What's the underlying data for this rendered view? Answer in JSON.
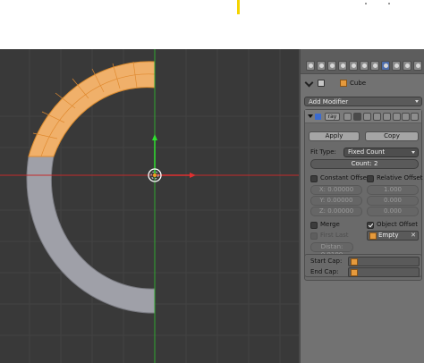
{
  "properties": {
    "context": {
      "object_name": "Cube"
    },
    "add_modifier_label": "Add Modifier",
    "modifier": {
      "name": "ray",
      "apply_label": "Apply",
      "copy_label": "Copy",
      "fit_type_label": "Fit Type:",
      "fit_type_value": "Fixed Count",
      "count_label": "Count: 2",
      "constant_offset_label": "Constant Offset",
      "relative_offset_label": "Relative Offset",
      "constant_offset_checked": false,
      "relative_offset_checked": false,
      "constant_x": "X: 0.00000",
      "constant_y": "Y: 0.00000",
      "constant_z": "Z: 0.00000",
      "relative_x": "1.000",
      "relative_y": "0.000",
      "relative_z": "0.000",
      "merge_label": "Merge",
      "merge_checked": false,
      "object_offset_label": "Object Offset",
      "object_offset_checked": true,
      "first_last_label": "First Last",
      "distance_label": "Distan: 0.0100",
      "offset_object": "Empty"
    },
    "start_cap_label": "Start Cap:",
    "end_cap_label": "End Cap:"
  },
  "colors": {
    "viewport_bg": "#393939",
    "selected_face": "#f0b06a",
    "unselected_face": "#9fa0a8",
    "axis_x": "#c42a2a",
    "axis_y": "#2fa82f",
    "panel_bg": "#727272",
    "accent": "#4f6eab"
  }
}
